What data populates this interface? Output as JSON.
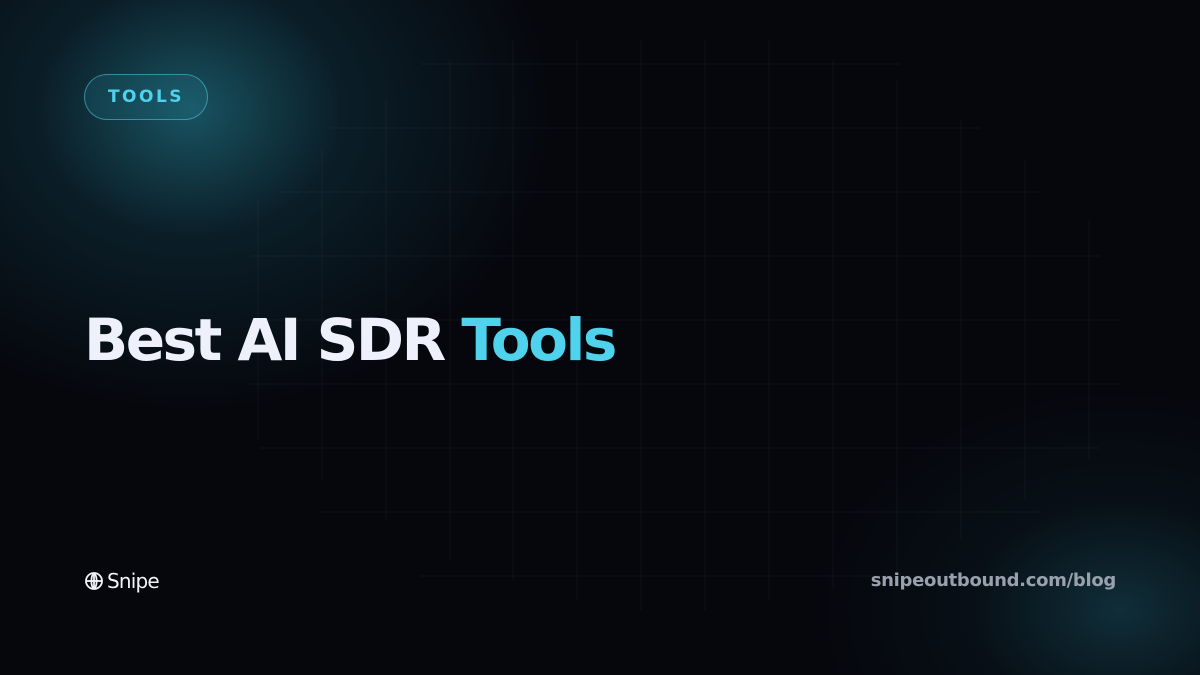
{
  "badge": {
    "label": "TOOLS"
  },
  "headline": {
    "main": "Best AI SDR ",
    "accent": "Tools"
  },
  "brand": {
    "name": "Snipe",
    "icon": "crosshair-globe-icon"
  },
  "footer": {
    "url": "snipeoutbound.com/blog"
  },
  "colors": {
    "background": "#06070d",
    "accent": "#4fd2ec",
    "headline": "#eef1fb",
    "url": "#9aa1ae"
  }
}
